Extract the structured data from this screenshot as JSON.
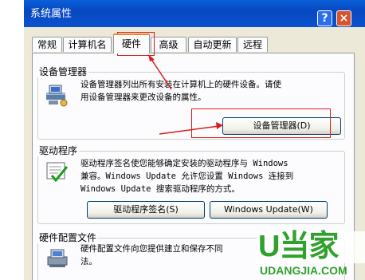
{
  "window": {
    "title": "系统属性",
    "help_symbol": "?",
    "close_symbol": "×"
  },
  "tabs": [
    {
      "label": "常规"
    },
    {
      "label": "计算机名"
    },
    {
      "label": "硬件"
    },
    {
      "label": "高级"
    },
    {
      "label": "自动更新"
    },
    {
      "label": "远程"
    }
  ],
  "device_manager": {
    "group_label": "设备管理器",
    "desc_line1": "设备管理器列出所有安装在计算机上的硬件设备。请使",
    "desc_line2": "用设备管理器来更改设备的属性。",
    "button_label": "设备管理器(D)",
    "icon": "device-manager-icon"
  },
  "drivers": {
    "group_label": "驱动程序",
    "desc_line1": "驱动程序签名使您能够确定安装的驱动程序与 Windows",
    "desc_line2": "兼容。Windows Update 允许您设置 Windows 连接到",
    "desc_line3": "Windows Update 搜索驱动程序的方式。",
    "signing_button": "驱动程序签名(S)",
    "update_button": "Windows Update(W)",
    "icon": "driver-signing-icon"
  },
  "hardware_profiles": {
    "group_label": "硬件配置文件",
    "desc_line1": "硬件配置文件向您提供建立和保存不同",
    "desc_line2": "法。",
    "icon": "hardware-profile-icon"
  },
  "watermark": {
    "brand": "U当家",
    "url": "UDANGJIA.COM"
  },
  "colors": {
    "annotation": "#d81c1c",
    "active_tab_accent": "#e68b2c",
    "brand_green": "#2fa12c"
  }
}
